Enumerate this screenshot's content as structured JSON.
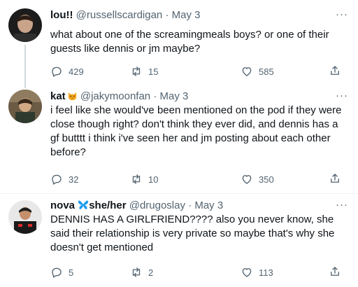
{
  "tweets": [
    {
      "name": "lou!!",
      "name_emoji": "",
      "pronouns": "",
      "handle": "@russellscardigan",
      "separator": "·",
      "date": "May 3",
      "more": "···",
      "text": "what about one of the screamingmeals boys? or one of their guests like dennis or jm maybe?",
      "replies": "429",
      "retweets": "15",
      "likes": "585"
    },
    {
      "name": "kat",
      "name_emoji": "cat-face-emoji",
      "pronouns": "",
      "handle": "@jakymoonfan",
      "separator": "·",
      "date": "May 3",
      "more": "···",
      "text": "i feel like she would've been mentioned on the pod if they were close though right? don't think they ever did, and dennis has a gf butttt i think i've seen her and jm posting about each other before?",
      "replies": "32",
      "retweets": "10",
      "likes": "350"
    },
    {
      "name": "nova",
      "name_emoji": "butterfly-emoji",
      "pronouns": "she/her",
      "handle": "@drugoslay",
      "separator": "·",
      "date": "May 3",
      "more": "···",
      "text": "DENNIS HAS A GIRLFRIEND???? also you never know, she said their relationship is very private so maybe that's why she doesn't get mentioned",
      "replies": "5",
      "retweets": "2",
      "likes": "113"
    }
  ],
  "colors": {
    "text": "#0f1419",
    "secondary": "#536471",
    "thread_line": "#cfd9de",
    "divider": "#eff3f4",
    "butterfly": "#1d9bf0",
    "cat": "#f4a81d"
  }
}
